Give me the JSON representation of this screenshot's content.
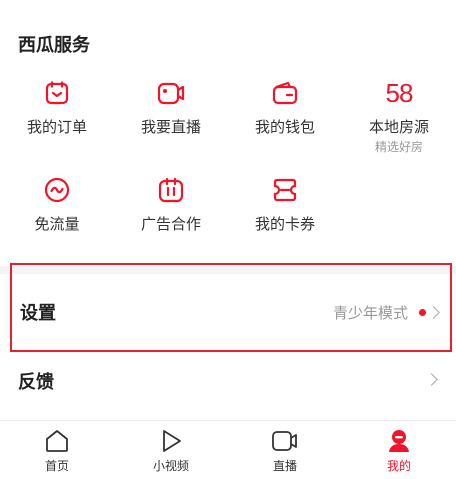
{
  "section": {
    "title": "西瓜服务"
  },
  "services": [
    {
      "label": "我的订单",
      "icon": "order-icon"
    },
    {
      "label": "我要直播",
      "icon": "live-camera-icon"
    },
    {
      "label": "我的钱包",
      "icon": "wallet-icon"
    },
    {
      "label": "本地房源",
      "icon": "58-logo-icon",
      "logo_text": "58",
      "sub": "精选好房"
    },
    {
      "label": "免流量",
      "icon": "data-free-icon"
    },
    {
      "label": "广告合作",
      "icon": "ad-cooperation-icon"
    },
    {
      "label": "我的卡券",
      "icon": "coupon-icon"
    }
  ],
  "settings": {
    "title": "设置",
    "youth_mode": "青少年模式"
  },
  "feedback": {
    "title": "反馈"
  },
  "tabbar": {
    "items": [
      {
        "label": "首页",
        "icon": "home-icon"
      },
      {
        "label": "小视频",
        "icon": "play-icon"
      },
      {
        "label": "直播",
        "icon": "live-icon"
      },
      {
        "label": "我的",
        "icon": "profile-icon",
        "active": true
      }
    ]
  },
  "colors": {
    "accent": "#f0152a",
    "text": "#222222",
    "muted": "#999999"
  }
}
